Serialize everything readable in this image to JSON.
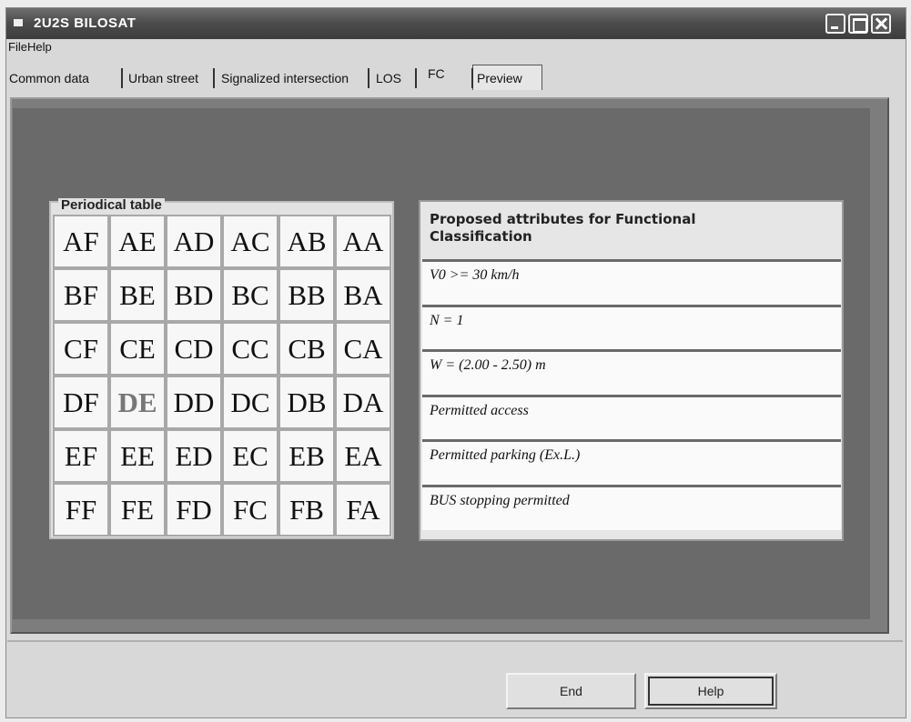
{
  "window": {
    "title": "2U2S BILOSAT"
  },
  "menu": {
    "items": [
      "File",
      "Help"
    ]
  },
  "tabs": [
    {
      "label": "Common data"
    },
    {
      "label": "Urban street"
    },
    {
      "label": "Signalized intersection"
    },
    {
      "label": "LOS"
    },
    {
      "label": "FC",
      "active": true
    },
    {
      "label": "Preview"
    }
  ],
  "periodic_table": {
    "legend": "Periodical table",
    "selected": "DE",
    "rows": [
      [
        "AF",
        "AE",
        "AD",
        "AC",
        "AB",
        "AA"
      ],
      [
        "BF",
        "BE",
        "BD",
        "BC",
        "BB",
        "BA"
      ],
      [
        "CF",
        "CE",
        "CD",
        "CC",
        "CB",
        "CA"
      ],
      [
        "DF",
        "DE",
        "DD",
        "DC",
        "DB",
        "DA"
      ],
      [
        "EF",
        "EE",
        "ED",
        "EC",
        "EB",
        "EA"
      ],
      [
        "FF",
        "FE",
        "FD",
        "FC",
        "FB",
        "FA"
      ]
    ]
  },
  "attributes": {
    "title": "Proposed attributes for Functional Classification",
    "items": [
      "V0 >= 30 km/h",
      "N = 1",
      "W = (2.00 - 2.50) m",
      "Permitted access",
      "Permitted parking (Ex.L.)",
      "BUS stopping permitted"
    ]
  },
  "buttons": {
    "end": "End",
    "help": "Help"
  },
  "colors": {
    "titlebar": "#4b4b4b",
    "panel": "#6a6a6a",
    "selected_cell_text": "#777777"
  }
}
